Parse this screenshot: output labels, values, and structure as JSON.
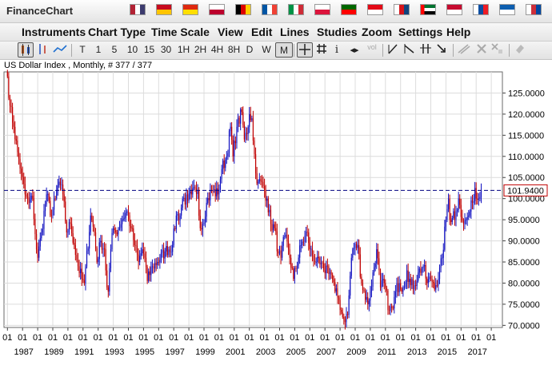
{
  "app": {
    "title": "FinanceChart"
  },
  "flags": [
    {
      "name": "us-flag-icon",
      "colors": [
        "#b22234",
        "#ffffff",
        "#3c3b6e"
      ]
    },
    {
      "name": "es-flag-icon",
      "colors": [
        "#c60b1e",
        "#ffc400"
      ]
    },
    {
      "name": "cn-flag-icon",
      "colors": [
        "#de2910",
        "#ffde00"
      ]
    },
    {
      "name": "jp-flag-icon",
      "colors": [
        "#ffffff",
        "#bc002d"
      ]
    },
    {
      "name": "de-flag-icon",
      "colors": [
        "#000000",
        "#dd0000",
        "#ffce00"
      ]
    },
    {
      "name": "fr-flag-icon",
      "colors": [
        "#0055a4",
        "#ffffff",
        "#ef4135"
      ]
    },
    {
      "name": "it-flag-icon",
      "colors": [
        "#009246",
        "#ffffff",
        "#ce2b37"
      ]
    },
    {
      "name": "pl-flag-icon",
      "colors": [
        "#ffffff",
        "#dc143c"
      ]
    },
    {
      "name": "pt-flag-icon",
      "colors": [
        "#006600",
        "#ff0000"
      ]
    },
    {
      "name": "tr-flag-icon",
      "colors": [
        "#e30a17",
        "#ffffff"
      ]
    },
    {
      "name": "cz-flag-icon",
      "colors": [
        "#ffffff",
        "#d7141a",
        "#11457e"
      ]
    },
    {
      "name": "ae-flag-icon",
      "colors": [
        "#00732f",
        "#ffffff",
        "#000000",
        "#ff0000"
      ]
    },
    {
      "name": "dk-flag-icon",
      "colors": [
        "#c60c30",
        "#ffffff"
      ]
    },
    {
      "name": "sk-flag-icon",
      "colors": [
        "#ffffff",
        "#0b4ea2",
        "#ee1c25"
      ]
    },
    {
      "name": "gr-flag-icon",
      "colors": [
        "#0d5eaf",
        "#ffffff"
      ]
    },
    {
      "name": "kr-flag-icon",
      "colors": [
        "#ffffff",
        "#cd2e3a",
        "#0047a0"
      ]
    }
  ],
  "menu": [
    "Instruments",
    "Chart Type",
    "Time Scale",
    "View",
    "Edit",
    "Lines",
    "Studies",
    "Zoom",
    "Settings",
    "Help"
  ],
  "toolbar": {
    "periods": [
      "T",
      "1",
      "5",
      "10",
      "15",
      "30",
      "1H",
      "2H",
      "4H",
      "8H",
      "D",
      "W",
      "M"
    ],
    "active_period": "M",
    "vol_label": "vol"
  },
  "chart_label": "US Dollar Index , Monthly, # 377 / 377",
  "chart_data": {
    "type": "candlestick",
    "title": "US Dollar Index , Monthly, # 377 / 377",
    "ylim": [
      69.5,
      130
    ],
    "y_ticks": [
      "125.0000",
      "120.0000",
      "115.0000",
      "110.0000",
      "105.0000",
      "100.0000",
      "95.0000",
      "90.0000",
      "85.0000",
      "80.0000",
      "75.0000",
      "70.0000"
    ],
    "y_tick_values": [
      125,
      120,
      115,
      110,
      105,
      100,
      95,
      90,
      85,
      80,
      75,
      70
    ],
    "x_tick_label": "01",
    "x_year_labels": [
      "1987",
      "1989",
      "1991",
      "1993",
      "1995",
      "1997",
      "1999",
      "2001",
      "2003",
      "2005",
      "2007",
      "2009",
      "2011",
      "2013",
      "2015",
      "2017"
    ],
    "start": "1986-01",
    "end": "2017-05",
    "last_price": "101.9400",
    "last_value": 101.94,
    "colors": {
      "up": "#1010c0",
      "down": "#c00000",
      "last_line": "#000080",
      "grid": "#dcdcdc",
      "last_box": "#c00000"
    },
    "anchors": [
      [
        "1986-01",
        128.9
      ],
      [
        "1986-03",
        122
      ],
      [
        "1986-06",
        117
      ],
      [
        "1986-09",
        111
      ],
      [
        "1986-12",
        106
      ],
      [
        "1987-03",
        101
      ],
      [
        "1987-06",
        99
      ],
      [
        "1987-09",
        100
      ],
      [
        "1987-12",
        88
      ],
      [
        "1988-01",
        86
      ],
      [
        "1988-04",
        92
      ],
      [
        "1988-08",
        101
      ],
      [
        "1988-12",
        96
      ],
      [
        "1989-03",
        100
      ],
      [
        "1989-06",
        104
      ],
      [
        "1989-09",
        101
      ],
      [
        "1989-12",
        92
      ],
      [
        "1990-03",
        94
      ],
      [
        "1990-06",
        89
      ],
      [
        "1990-09",
        84
      ],
      [
        "1990-12",
        81
      ],
      [
        "1991-02",
        80
      ],
      [
        "1991-07",
        96
      ],
      [
        "1991-10",
        92
      ],
      [
        "1991-12",
        85
      ],
      [
        "1992-03",
        90
      ],
      [
        "1992-06",
        88
      ],
      [
        "1992-08",
        79
      ],
      [
        "1992-09",
        78
      ],
      [
        "1992-11",
        88
      ],
      [
        "1993-01",
        93
      ],
      [
        "1993-03",
        92
      ],
      [
        "1993-08",
        95
      ],
      [
        "1993-12",
        97
      ],
      [
        "1994-03",
        93
      ],
      [
        "1994-06",
        89
      ],
      [
        "1994-09",
        85
      ],
      [
        "1994-12",
        88
      ],
      [
        "1995-02",
        86
      ],
      [
        "1995-04",
        80.5
      ],
      [
        "1995-08",
        84
      ],
      [
        "1995-12",
        85
      ],
      [
        "1996-06",
        87.5
      ],
      [
        "1996-12",
        89
      ],
      [
        "1997-03",
        96
      ],
      [
        "1997-06",
        96
      ],
      [
        "1997-08",
        100
      ],
      [
        "1997-12",
        99.5
      ],
      [
        "1998-03",
        101
      ],
      [
        "1998-08",
        102
      ],
      [
        "1998-10",
        93
      ],
      [
        "1998-12",
        94
      ],
      [
        "1999-03",
        99
      ],
      [
        "1999-07",
        102
      ],
      [
        "1999-12",
        101
      ],
      [
        "2000-03",
        107
      ],
      [
        "2000-07",
        110
      ],
      [
        "2000-10",
        117
      ],
      [
        "2000-12",
        110
      ],
      [
        "2001-03",
        117
      ],
      [
        "2001-07",
        120.5
      ],
      [
        "2001-09",
        114
      ],
      [
        "2001-12",
        117
      ],
      [
        "2002-01",
        120
      ],
      [
        "2002-03",
        119
      ],
      [
        "2002-06",
        106
      ],
      [
        "2002-08",
        104
      ],
      [
        "2002-12",
        103
      ],
      [
        "2003-03",
        100
      ],
      [
        "2003-06",
        94
      ],
      [
        "2003-09",
        93
      ],
      [
        "2003-12",
        87
      ],
      [
        "2004-02",
        86
      ],
      [
        "2004-05",
        91
      ],
      [
        "2004-08",
        88
      ],
      [
        "2004-12",
        81
      ],
      [
        "2005-06",
        89
      ],
      [
        "2005-11",
        92
      ],
      [
        "2006-01",
        88
      ],
      [
        "2006-06",
        85
      ],
      [
        "2006-12",
        83
      ],
      [
        "2007-03",
        84
      ],
      [
        "2007-06",
        82
      ],
      [
        "2007-09",
        78
      ],
      [
        "2007-12",
        76
      ],
      [
        "2008-03",
        72
      ],
      [
        "2008-04",
        71.5
      ],
      [
        "2008-07",
        72.5
      ],
      [
        "2008-10",
        86
      ],
      [
        "2008-11",
        88
      ],
      [
        "2009-03",
        89
      ],
      [
        "2009-06",
        80
      ],
      [
        "2009-11",
        75
      ],
      [
        "2010-01",
        78
      ],
      [
        "2010-06",
        88
      ],
      [
        "2010-09",
        79
      ],
      [
        "2010-12",
        80
      ],
      [
        "2011-04",
        73.5
      ],
      [
        "2011-07",
        74
      ],
      [
        "2011-09",
        78
      ],
      [
        "2011-12",
        80
      ],
      [
        "2012-03",
        79
      ],
      [
        "2012-06",
        83
      ],
      [
        "2012-09",
        79.5
      ],
      [
        "2012-12",
        79.5
      ],
      [
        "2013-03",
        82.5
      ],
      [
        "2013-07",
        84
      ],
      [
        "2013-10",
        80
      ],
      [
        "2014-01",
        81
      ],
      [
        "2014-05",
        79.5
      ],
      [
        "2014-07",
        81
      ],
      [
        "2014-10",
        86
      ],
      [
        "2015-01",
        95
      ],
      [
        "2015-03",
        100
      ],
      [
        "2015-04",
        95
      ],
      [
        "2015-07",
        97
      ],
      [
        "2015-08",
        95
      ],
      [
        "2015-11",
        100
      ],
      [
        "2015-12",
        98.5
      ],
      [
        "2016-03",
        94
      ],
      [
        "2016-05",
        95
      ],
      [
        "2016-07",
        96
      ],
      [
        "2016-10",
        99
      ],
      [
        "2016-12",
        102.5
      ],
      [
        "2017-01",
        100
      ],
      [
        "2017-03",
        100
      ],
      [
        "2017-05",
        101.94
      ]
    ]
  }
}
